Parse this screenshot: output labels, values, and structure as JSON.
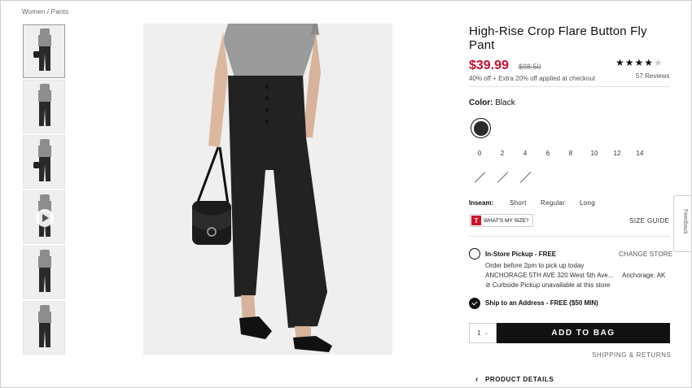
{
  "breadcrumb": "Women / Pants",
  "product": {
    "title": "High-Rise Crop Flare Button Fly Pant",
    "price": "$39.99",
    "original_price": "$98.50",
    "promo": "40% off + Extra 20% off applied at checkout",
    "rating_stars": 4.5,
    "stars_filled": "★★★★",
    "stars_empty": "★",
    "reviews": "57 Reviews",
    "price_color": "#c8102e"
  },
  "color": {
    "label": "Color:",
    "value": "Black",
    "swatch_hex": "#2a2a2a"
  },
  "sizes": [
    "0",
    "2",
    "4",
    "6",
    "8",
    "10",
    "12",
    "14"
  ],
  "unavailable_sizes_count_icons": [
    "slash-icon",
    "slash-icon",
    "slash-icon"
  ],
  "inseam": {
    "label": "Inseam:",
    "options": [
      "Short",
      "Regular",
      "Long"
    ]
  },
  "whats_my_size": {
    "logo": "T",
    "label": "WHAT'S MY SIZE?"
  },
  "size_guide": "SIZE GUIDE",
  "feedback": "Feedback",
  "pickup": {
    "title": "In-Store Pickup - FREE",
    "change_store": "CHANGE STORE",
    "order_by": "Order before 2pm to pick up today",
    "store": "ANCHORAGE 5TH AVE 320 West 5th Ave...",
    "city": "Anchorage, AK",
    "curbside": "⊘ Curbside Pickup unavailable at this store"
  },
  "ship": {
    "title": "Ship to an Address - FREE ($50 MIN)"
  },
  "quantity": "1",
  "add_to_bag": "ADD TO BAG",
  "shipping_returns": "SHIPPING & RETURNS",
  "product_details": "PRODUCT DETAILS"
}
